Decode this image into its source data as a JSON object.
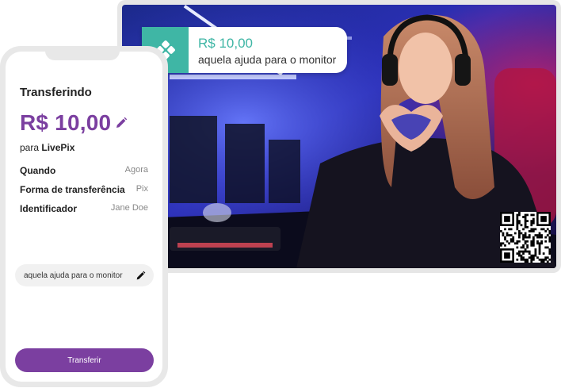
{
  "alert": {
    "amount": "R$ 10,00",
    "message": "aquela ajuda para o monitor",
    "logo_icon": "livepix-diamond-icon",
    "accent_color": "#3fb6a5"
  },
  "phone": {
    "title": "Transferindo",
    "amount": "R$ 10,00",
    "recipient_prefix": "para",
    "recipient_name": "LivePix",
    "details": [
      {
        "label": "Quando",
        "value": "Agora"
      },
      {
        "label": "Forma de transferência",
        "value": "Pix"
      },
      {
        "label": "Identificador",
        "value": "Jane Doe"
      }
    ],
    "message": "aquela ajuda para o monitor",
    "button_label": "Transferir",
    "accent_color": "#7b3fa0",
    "edit_icon": "pencil-icon"
  },
  "qr_icon": "qr-code-icon"
}
